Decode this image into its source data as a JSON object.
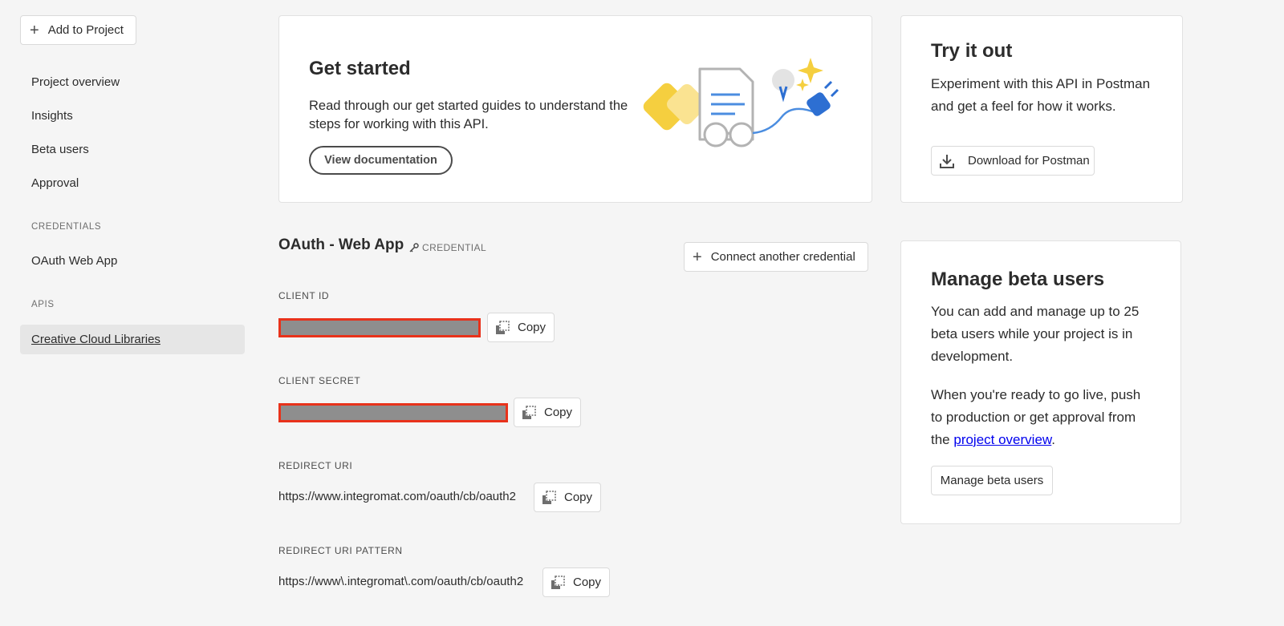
{
  "sidebar": {
    "add_to_project": "Add to Project",
    "items": [
      "Project overview",
      "Insights",
      "Beta users",
      "Approval"
    ],
    "credentials_header": "CREDENTIALS",
    "credentials_items": [
      "OAuth Web App"
    ],
    "apis_header": "APIS",
    "apis_items": [
      "Creative Cloud Libraries"
    ]
  },
  "get_started": {
    "title": "Get started",
    "description": "Read through our get started guides to understand the steps for working with this API.",
    "button": "View documentation"
  },
  "try_it_out": {
    "title": "Try it out",
    "description": "Experiment with this API in Postman and get a feel for how it works.",
    "button": "Download for Postman"
  },
  "credential": {
    "title": "OAuth - Web App",
    "tag": "CREDENTIAL",
    "connect_button": "Connect another credential",
    "fields": [
      {
        "label": "CLIENT ID",
        "value": "",
        "redacted": true
      },
      {
        "label": "CLIENT SECRET",
        "value": "",
        "redacted": true
      },
      {
        "label": "REDIRECT URI",
        "value": "https://www.integromat.com/oauth/cb/oauth2",
        "redacted": false
      },
      {
        "label": "REDIRECT URI PATTERN",
        "value": "https://www\\.integromat\\.com/oauth/cb/oauth2",
        "redacted": false
      }
    ],
    "copy_label": "Copy"
  },
  "beta": {
    "title": "Manage beta users",
    "paragraph1": "You can add and manage up to 25 beta users while your project is in development.",
    "paragraph2_prefix": "When you're ready to go live, push to production or get approval from the ",
    "paragraph2_link": "project overview",
    "paragraph2_suffix": ".",
    "button": "Manage beta users"
  },
  "colors": {
    "redaction_border": "#e8321b",
    "redaction_fill": "#8e8e8e",
    "link": "#0000ee",
    "active_nav_bg": "#e6e6e6"
  }
}
